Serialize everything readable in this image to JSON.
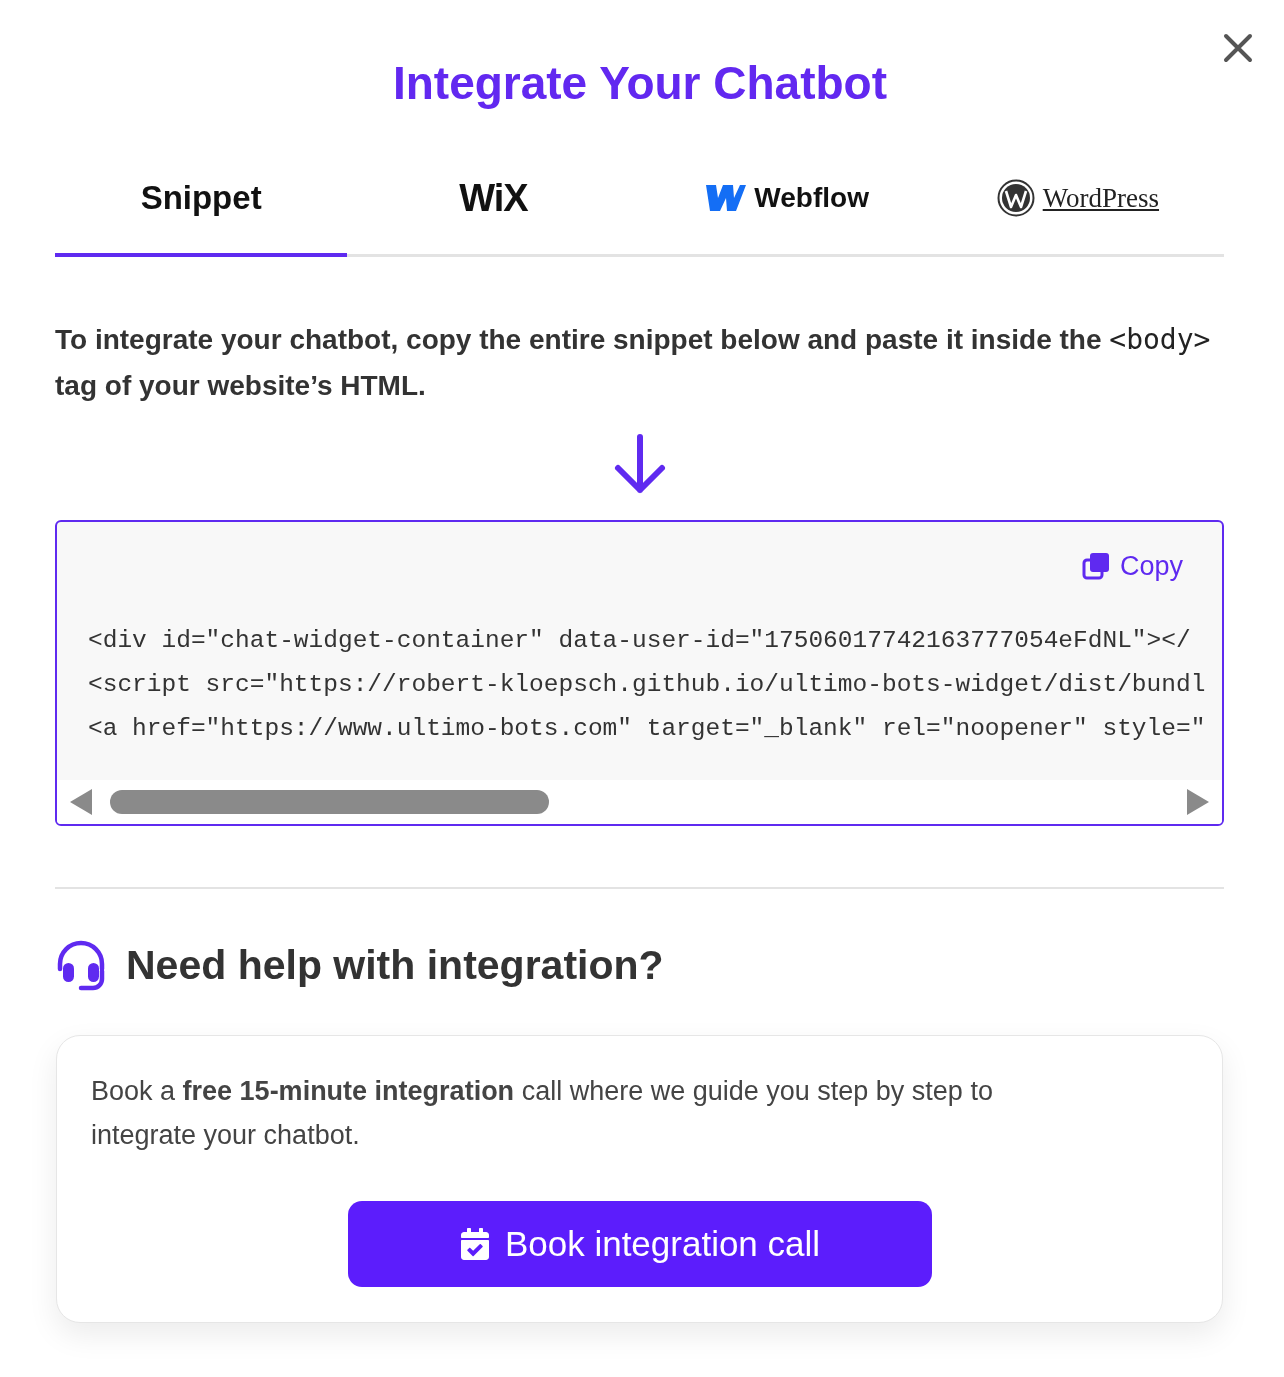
{
  "title": "Integrate Your Chatbot",
  "tabs": [
    {
      "label": "Snippet",
      "kind": "text",
      "selected": true
    },
    {
      "label": "WiX",
      "kind": "wix",
      "selected": false
    },
    {
      "label": "Webflow",
      "kind": "webflow",
      "selected": false
    },
    {
      "label": "WordPress",
      "kind": "wordpress",
      "selected": false
    }
  ],
  "instructions": {
    "before": "To integrate your chatbot, copy the entire snippet below and paste it inside the",
    "code": "<body>",
    "after": "tag of your website’s HTML."
  },
  "snippet": {
    "copy_button": "Copy",
    "lines": [
      "<div id=\"chat-widget-container\" data-user-id=\"17506017742163777054eFdNL\"></",
      "<script src=\"https://robert-kloepsch.github.io/ultimo-bots-widget/dist/bundl",
      "<a href=\"https://www.ultimo-bots.com\" target=\"_blank\" rel=\"noopener\" style=\""
    ]
  },
  "help": {
    "heading": "Need help with integration?",
    "description": "Book a **free 15-minute integration** call where we guide you step by step to integrate your chatbot.",
    "button": "Book integration call"
  }
}
